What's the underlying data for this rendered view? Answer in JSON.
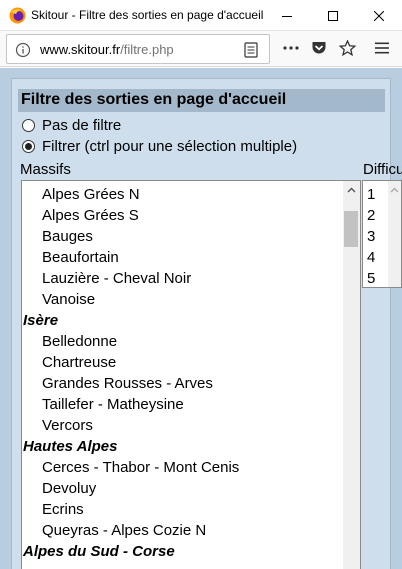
{
  "window": {
    "title": "Skitour - Filtre des sorties en page d'accueil",
    "colors": {
      "page_bg": "#b8cde0",
      "panel_bg": "#cfdeec",
      "panel_title_bg": "#a4b8cc"
    }
  },
  "navbar": {
    "url_host": "www.skitour.fr",
    "url_path": "/filtre.php",
    "icons": [
      "info-icon",
      "reader-view-icon",
      "more-icon",
      "pocket-icon",
      "bookmark-star-icon",
      "hamburger-menu-icon"
    ]
  },
  "panel": {
    "title": "Filtre des sorties en page d'accueil",
    "radio_no_filter": "Pas de filtre",
    "radio_filter": "Filtrer (ctrl pour une sélection multiple)",
    "selected_radio": "filter",
    "massifs_label": "Massifs",
    "difficulty_label": "Difficu"
  },
  "massifs": [
    {
      "type": "option",
      "label": "Alpes Grées N"
    },
    {
      "type": "option",
      "label": "Alpes Grées S"
    },
    {
      "type": "option",
      "label": "Bauges"
    },
    {
      "type": "option",
      "label": "Beaufortain"
    },
    {
      "type": "option",
      "label": "Lauzière - Cheval Noir"
    },
    {
      "type": "option",
      "label": "Vanoise"
    },
    {
      "type": "group",
      "label": "Isère"
    },
    {
      "type": "option",
      "label": "Belledonne"
    },
    {
      "type": "option",
      "label": "Chartreuse"
    },
    {
      "type": "option",
      "label": "Grandes Rousses - Arves"
    },
    {
      "type": "option",
      "label": "Taillefer - Matheysine"
    },
    {
      "type": "option",
      "label": "Vercors"
    },
    {
      "type": "group",
      "label": "Hautes Alpes"
    },
    {
      "type": "option",
      "label": "Cerces - Thabor - Mont Cenis"
    },
    {
      "type": "option",
      "label": "Devoluy"
    },
    {
      "type": "option",
      "label": "Ecrins"
    },
    {
      "type": "option",
      "label": "Queyras - Alpes Cozie N"
    },
    {
      "type": "group",
      "label": "Alpes du Sud - Corse"
    }
  ],
  "difficulties": [
    "1",
    "2",
    "3",
    "4",
    "5"
  ]
}
